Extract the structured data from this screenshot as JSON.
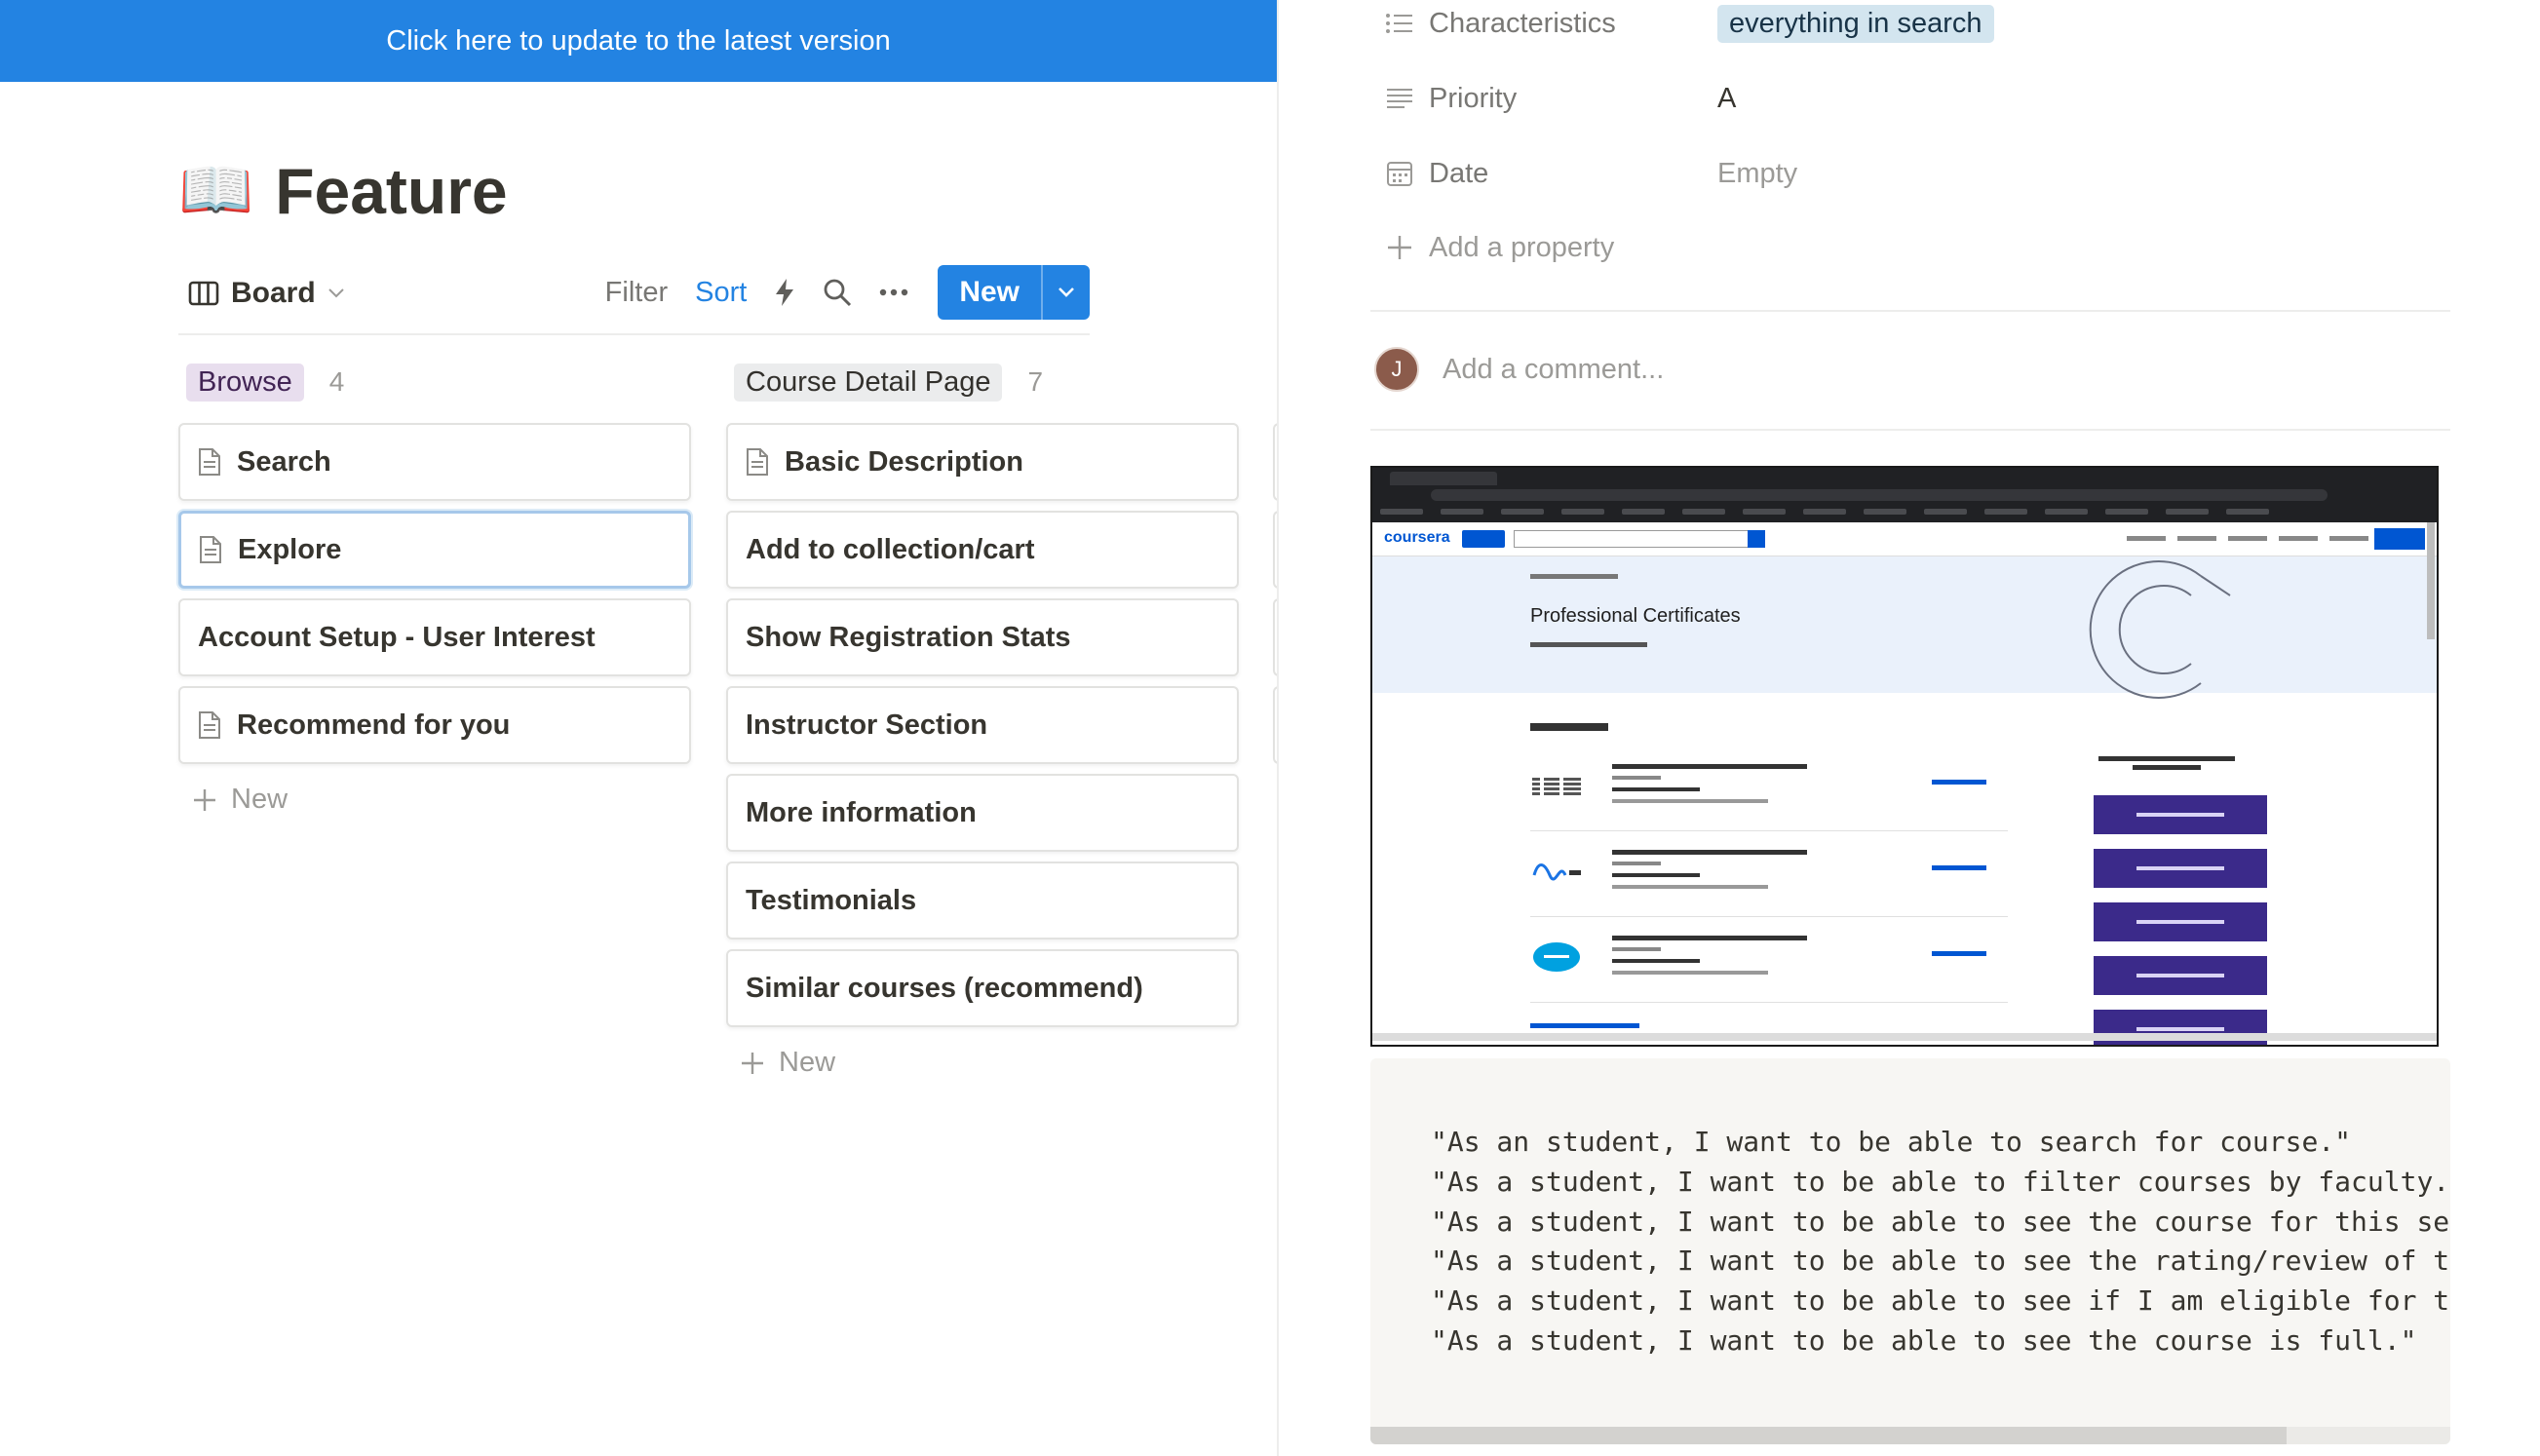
{
  "banner": {
    "text": "Click here to update to the latest version"
  },
  "page": {
    "emoji": "📖",
    "title": "Feature"
  },
  "toolbar": {
    "view_label": "Board",
    "filter_label": "Filter",
    "sort_label": "Sort",
    "new_label": "New"
  },
  "board": {
    "columns": [
      {
        "tag": "Browse",
        "count": "4",
        "tag_color": "#e8deee",
        "cards": [
          {
            "title": "Search",
            "icon": "page-icon"
          },
          {
            "title": "Explore",
            "icon": "page-icon",
            "selected": true
          },
          {
            "title": "Account Setup - User Interest"
          },
          {
            "title": "Recommend for you",
            "icon": "page-icon"
          }
        ],
        "add_label": "New"
      },
      {
        "tag": "Course Detail Page",
        "count": "7",
        "tag_color": "#ebeced",
        "cards": [
          {
            "title": "Basic Description",
            "icon": "page-icon"
          },
          {
            "title": "Add to collection/cart"
          },
          {
            "title": "Show Registration Stats"
          },
          {
            "title": "Instructor Section"
          },
          {
            "title": "More information"
          },
          {
            "title": "Testimonials"
          },
          {
            "title": "Similar courses (recommend)"
          }
        ],
        "add_label": "New"
      }
    ]
  },
  "properties": [
    {
      "name": "Characteristics",
      "value": "everything in search",
      "icon": "list-icon",
      "chip_color": "#d3e5ef"
    },
    {
      "name": "Priority",
      "value": "A",
      "icon": "text-lines-icon"
    },
    {
      "name": "Date",
      "value": "Empty",
      "icon": "calendar-icon"
    }
  ],
  "add_property_label": "Add a property",
  "comment": {
    "avatar_initial": "J",
    "placeholder": "Add a comment..."
  },
  "embedded_screenshot": {
    "logo": "coursera",
    "title": "Professional Certificates"
  },
  "code_lines": [
    "\"As an student, I want to be able to search for course.\"",
    "\"As a student, I want to be able to filter courses by faculty.\"",
    "\"As a student, I want to be able to see the course for this seme",
    "\"As a student, I want to be able to see the rating/review of the",
    "\"As a student, I want to be able to see if I am eligible for thi",
    "\"As a student, I want to be able to see the course is full.\""
  ],
  "colors": {
    "accent": "#2383e2",
    "text": "#37352f",
    "muted": "#9b9a97"
  }
}
